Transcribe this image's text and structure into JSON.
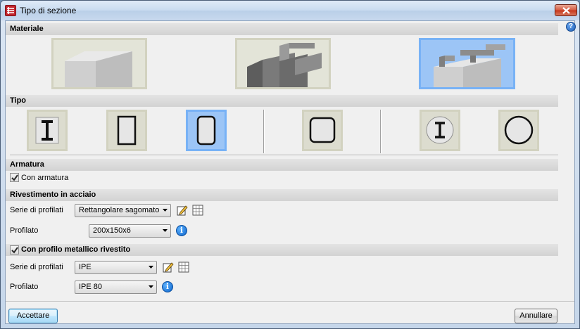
{
  "window": {
    "title": "Tipo di sezione"
  },
  "help": {
    "symbol": "?"
  },
  "sections": {
    "materiale": "Materiale",
    "tipo": "Tipo",
    "armatura": "Armatura",
    "rivestimento": "Rivestimento in acciaio",
    "profilo_metallico": "Con profilo metallico rivestito"
  },
  "material_tiles": [
    {
      "icon": "concrete-block-icon",
      "selected": false
    },
    {
      "icon": "steel-section-icon",
      "selected": false
    },
    {
      "icon": "composite-section-icon",
      "selected": true
    }
  ],
  "tipo_tiles": [
    {
      "icon": "encased-i-beam-icon",
      "selected": false
    },
    {
      "icon": "rectangular-section-icon",
      "selected": false
    },
    {
      "icon": "rounded-rectangular-section-icon",
      "selected": true
    },
    {
      "icon": "rounded-square-section-icon",
      "selected": false
    },
    {
      "icon": "circular-encased-i-beam-icon",
      "selected": false
    },
    {
      "icon": "circular-section-icon",
      "selected": false
    }
  ],
  "armatura": {
    "checkbox_label": "Con armatura",
    "checked": true
  },
  "rivestimento": {
    "series_label": "Serie di profilati",
    "series_value": "Rettangolare sagomato",
    "profile_label": "Profilato",
    "profile_value": "200x150x6"
  },
  "profilo_metallico": {
    "checked": true,
    "series_label": "Serie di profilati",
    "series_value": "IPE",
    "profile_label": "Profilato",
    "profile_value": "IPE 80"
  },
  "buttons": {
    "accept": "Accettare",
    "cancel": "Annullare"
  },
  "colors": {
    "selected_tile": "#9cc5f6",
    "tile": "#dcdccf",
    "header": "#d9d9d9"
  }
}
